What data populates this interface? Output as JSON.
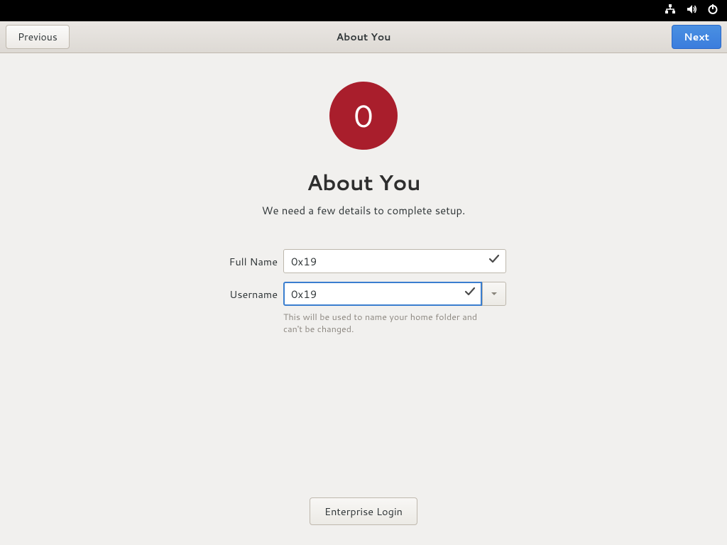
{
  "topbar": {
    "icons": [
      "network-icon",
      "volume-icon",
      "power-icon"
    ]
  },
  "header": {
    "previous_label": "Previous",
    "title": "About You",
    "next_label": "Next"
  },
  "avatar": {
    "initial": "0",
    "bg_color": "#a91e2c"
  },
  "page": {
    "title": "About You",
    "subtitle": "We need a few details to complete setup."
  },
  "form": {
    "fullname_label": "Full Name",
    "fullname_value": "0x19",
    "username_label": "Username",
    "username_value": "0x19",
    "username_hint": "This will be used to name your home folder and can't be changed."
  },
  "footer": {
    "enterprise_label": "Enterprise Login"
  }
}
